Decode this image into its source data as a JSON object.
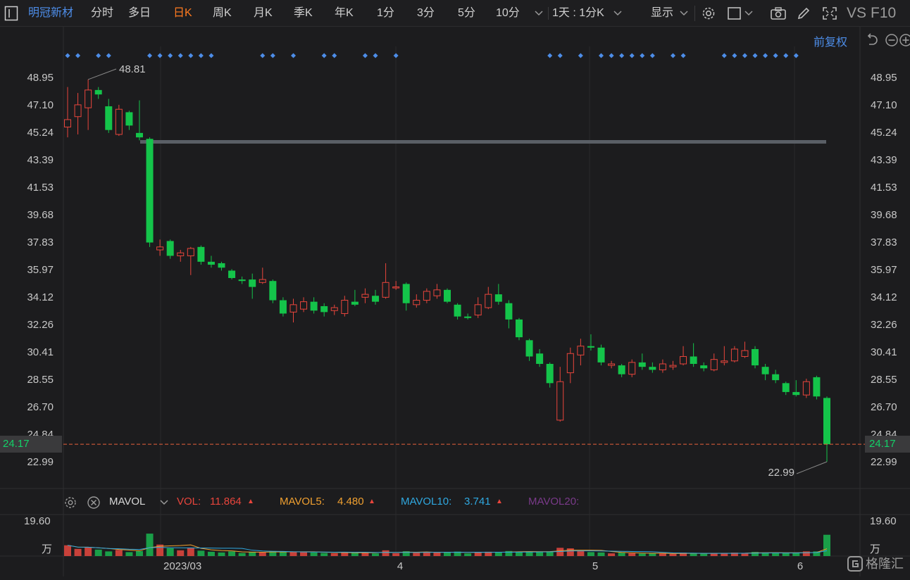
{
  "toolbar": {
    "stock_name": "明冠新材",
    "periods": [
      "分时",
      "多日",
      "日K",
      "周K",
      "月K",
      "季K",
      "年K",
      "1分",
      "3分",
      "5分",
      "10分"
    ],
    "active_period": "日K",
    "range_select": "1天 : 1分K",
    "display_label": "显示",
    "vs_label": "VS",
    "f10_label": "F10"
  },
  "chart_header": {
    "adjust_label": "前复权"
  },
  "price_axis": {
    "ticks": [
      "48.95",
      "47.10",
      "45.24",
      "43.39",
      "41.53",
      "39.68",
      "37.83",
      "35.97",
      "34.12",
      "32.26",
      "30.41",
      "28.55",
      "26.70",
      "24.84",
      "22.99"
    ],
    "current_price": "24.17",
    "high_label": "48.81",
    "low_label": "22.99"
  },
  "volume_panel": {
    "indicator": "MAVOL",
    "vol_label": "VOL:",
    "vol_value": "11.864",
    "mavol5_label": "MAVOL5:",
    "mavol5_value": "4.480",
    "mavol10_label": "MAVOL10:",
    "mavol10_value": "3.741",
    "mavol20_label": "MAVOL20:",
    "axis_max": "19.60",
    "axis_unit": "万"
  },
  "x_axis": {
    "labels": [
      "2023/03",
      "4",
      "5",
      "6"
    ]
  },
  "watermark": "格隆汇",
  "colors": {
    "up": "#e8453c",
    "down": "#14c44a",
    "accent": "#ff7a1f",
    "mavol5": "#f0a030",
    "mavol10": "#2fa8e0",
    "mavol20": "#8a3a9a",
    "stock": "#4d8de8"
  },
  "chart_data": {
    "type": "candlestick",
    "x_labels": [
      "2023/03",
      "4",
      "5",
      "6"
    ],
    "candles": [
      {
        "o": 45.6,
        "c": 46.1,
        "h": 48.3,
        "l": 44.9,
        "v": 6.0
      },
      {
        "o": 46.3,
        "c": 47.1,
        "h": 47.9,
        "l": 45.1,
        "v": 4.0
      },
      {
        "o": 46.9,
        "c": 48.1,
        "h": 48.81,
        "l": 45.4,
        "v": 4.8
      },
      {
        "o": 48.1,
        "c": 47.8,
        "h": 48.3,
        "l": 47.5,
        "v": 3.6
      },
      {
        "o": 47.0,
        "c": 45.4,
        "h": 47.5,
        "l": 45.2,
        "v": 2.6
      },
      {
        "o": 45.1,
        "c": 46.8,
        "h": 47.1,
        "l": 45.0,
        "v": 3.4
      },
      {
        "o": 46.6,
        "c": 45.7,
        "h": 46.7,
        "l": 45.4,
        "v": 2.2
      },
      {
        "o": 45.2,
        "c": 44.9,
        "h": 47.4,
        "l": 44.7,
        "v": 2.8
      },
      {
        "o": 44.8,
        "c": 37.8,
        "h": 44.9,
        "l": 37.5,
        "v": 12.5
      },
      {
        "o": 37.3,
        "c": 37.5,
        "h": 38.0,
        "l": 36.9,
        "v": 6.4
      },
      {
        "o": 37.9,
        "c": 36.9,
        "h": 38.0,
        "l": 36.7,
        "v": 4.4
      },
      {
        "o": 36.9,
        "c": 37.1,
        "h": 37.3,
        "l": 36.5,
        "v": 3.2
      },
      {
        "o": 36.9,
        "c": 37.4,
        "h": 37.5,
        "l": 35.6,
        "v": 4.5
      },
      {
        "o": 37.5,
        "c": 36.5,
        "h": 37.6,
        "l": 36.3,
        "v": 3.0
      },
      {
        "o": 36.5,
        "c": 36.3,
        "h": 36.9,
        "l": 36.1,
        "v": 2.4
      },
      {
        "o": 36.4,
        "c": 36.1,
        "h": 36.5,
        "l": 35.9,
        "v": 2.0
      },
      {
        "o": 35.9,
        "c": 35.4,
        "h": 36.0,
        "l": 35.3,
        "v": 2.6
      },
      {
        "o": 35.3,
        "c": 35.2,
        "h": 35.5,
        "l": 35.0,
        "v": 1.7
      },
      {
        "o": 35.3,
        "c": 34.8,
        "h": 35.7,
        "l": 34.0,
        "v": 2.4
      },
      {
        "o": 35.1,
        "c": 35.3,
        "h": 36.1,
        "l": 35.0,
        "v": 2.0
      },
      {
        "o": 35.2,
        "c": 33.9,
        "h": 35.3,
        "l": 33.7,
        "v": 2.8
      },
      {
        "o": 33.9,
        "c": 33.0,
        "h": 34.1,
        "l": 32.8,
        "v": 2.5
      },
      {
        "o": 33.1,
        "c": 33.6,
        "h": 34.0,
        "l": 32.4,
        "v": 2.4
      },
      {
        "o": 33.3,
        "c": 33.8,
        "h": 34.1,
        "l": 33.1,
        "v": 2.3
      },
      {
        "o": 33.8,
        "c": 33.2,
        "h": 34.1,
        "l": 33.0,
        "v": 2.0
      },
      {
        "o": 33.5,
        "c": 33.1,
        "h": 33.7,
        "l": 32.8,
        "v": 1.7
      },
      {
        "o": 33.2,
        "c": 33.4,
        "h": 33.6,
        "l": 32.9,
        "v": 1.6
      },
      {
        "o": 33.0,
        "c": 33.9,
        "h": 34.2,
        "l": 32.8,
        "v": 2.2
      },
      {
        "o": 33.8,
        "c": 33.6,
        "h": 34.6,
        "l": 33.5,
        "v": 1.8
      },
      {
        "o": 34.1,
        "c": 34.3,
        "h": 34.7,
        "l": 33.7,
        "v": 2.1
      },
      {
        "o": 34.2,
        "c": 33.8,
        "h": 34.6,
        "l": 33.6,
        "v": 1.5
      },
      {
        "o": 34.1,
        "c": 35.1,
        "h": 36.4,
        "l": 34.0,
        "v": 3.2
      },
      {
        "o": 34.8,
        "c": 34.8,
        "h": 35.2,
        "l": 34.6,
        "v": 1.6
      },
      {
        "o": 35.0,
        "c": 33.7,
        "h": 35.1,
        "l": 33.2,
        "v": 2.7
      },
      {
        "o": 33.6,
        "c": 33.9,
        "h": 34.3,
        "l": 33.4,
        "v": 1.9
      },
      {
        "o": 33.9,
        "c": 34.5,
        "h": 34.7,
        "l": 33.7,
        "v": 2.2
      },
      {
        "o": 34.2,
        "c": 34.6,
        "h": 35.0,
        "l": 34.0,
        "v": 2.0
      },
      {
        "o": 34.6,
        "c": 33.8,
        "h": 34.7,
        "l": 33.7,
        "v": 2.0
      },
      {
        "o": 33.6,
        "c": 32.8,
        "h": 33.7,
        "l": 32.6,
        "v": 2.5
      },
      {
        "o": 32.8,
        "c": 32.7,
        "h": 33.0,
        "l": 32.6,
        "v": 1.5
      },
      {
        "o": 32.9,
        "c": 33.6,
        "h": 34.1,
        "l": 32.7,
        "v": 2.2
      },
      {
        "o": 33.4,
        "c": 34.3,
        "h": 34.8,
        "l": 33.3,
        "v": 2.4
      },
      {
        "o": 34.3,
        "c": 33.8,
        "h": 35.0,
        "l": 33.6,
        "v": 2.2
      },
      {
        "o": 33.7,
        "c": 32.6,
        "h": 33.9,
        "l": 32.0,
        "v": 2.8
      },
      {
        "o": 32.6,
        "c": 31.4,
        "h": 32.7,
        "l": 31.2,
        "v": 2.4
      },
      {
        "o": 31.2,
        "c": 30.1,
        "h": 31.3,
        "l": 29.8,
        "v": 2.6
      },
      {
        "o": 30.3,
        "c": 29.6,
        "h": 30.6,
        "l": 29.4,
        "v": 2.2
      },
      {
        "o": 29.6,
        "c": 28.3,
        "h": 29.7,
        "l": 28.0,
        "v": 2.6
      },
      {
        "o": 25.8,
        "c": 28.4,
        "h": 29.4,
        "l": 25.7,
        "v": 4.6
      },
      {
        "o": 29.0,
        "c": 30.3,
        "h": 30.7,
        "l": 28.3,
        "v": 4.3
      },
      {
        "o": 30.2,
        "c": 30.8,
        "h": 31.3,
        "l": 29.5,
        "v": 2.8
      },
      {
        "o": 30.8,
        "c": 30.7,
        "h": 31.6,
        "l": 30.5,
        "v": 2.2
      },
      {
        "o": 30.7,
        "c": 29.7,
        "h": 30.9,
        "l": 29.5,
        "v": 2.0
      },
      {
        "o": 29.5,
        "c": 29.6,
        "h": 29.8,
        "l": 29.3,
        "v": 1.5
      },
      {
        "o": 29.5,
        "c": 28.9,
        "h": 29.6,
        "l": 28.7,
        "v": 1.9
      },
      {
        "o": 28.9,
        "c": 29.7,
        "h": 29.9,
        "l": 28.7,
        "v": 1.6
      },
      {
        "o": 29.7,
        "c": 29.4,
        "h": 30.3,
        "l": 29.2,
        "v": 1.4
      },
      {
        "o": 29.4,
        "c": 29.2,
        "h": 29.7,
        "l": 29.0,
        "v": 1.5
      },
      {
        "o": 29.2,
        "c": 29.6,
        "h": 29.9,
        "l": 29.0,
        "v": 1.4
      },
      {
        "o": 29.4,
        "c": 29.5,
        "h": 29.8,
        "l": 29.2,
        "v": 1.2
      },
      {
        "o": 29.6,
        "c": 30.1,
        "h": 30.8,
        "l": 29.5,
        "v": 1.9
      },
      {
        "o": 30.1,
        "c": 29.6,
        "h": 31.0,
        "l": 29.4,
        "v": 1.6
      },
      {
        "o": 29.5,
        "c": 29.3,
        "h": 29.7,
        "l": 29.1,
        "v": 1.3
      },
      {
        "o": 29.2,
        "c": 29.9,
        "h": 30.3,
        "l": 29.1,
        "v": 1.6
      },
      {
        "o": 29.7,
        "c": 29.8,
        "h": 30.8,
        "l": 29.5,
        "v": 1.5
      },
      {
        "o": 29.8,
        "c": 30.6,
        "h": 30.8,
        "l": 29.7,
        "v": 1.9
      },
      {
        "o": 30.1,
        "c": 30.5,
        "h": 31.1,
        "l": 30.0,
        "v": 1.7
      },
      {
        "o": 30.6,
        "c": 29.5,
        "h": 30.8,
        "l": 29.3,
        "v": 2.3
      },
      {
        "o": 29.4,
        "c": 28.9,
        "h": 29.6,
        "l": 28.5,
        "v": 2.0
      },
      {
        "o": 28.9,
        "c": 28.5,
        "h": 29.2,
        "l": 28.3,
        "v": 1.6
      },
      {
        "o": 28.3,
        "c": 27.7,
        "h": 28.4,
        "l": 27.5,
        "v": 1.7
      },
      {
        "o": 27.7,
        "c": 27.5,
        "h": 28.5,
        "l": 27.4,
        "v": 1.6
      },
      {
        "o": 27.5,
        "c": 28.4,
        "h": 28.6,
        "l": 27.3,
        "v": 2.6
      },
      {
        "o": 28.7,
        "c": 27.4,
        "h": 28.8,
        "l": 27.2,
        "v": 2.6
      },
      {
        "o": 27.3,
        "c": 24.17,
        "h": 27.4,
        "l": 22.99,
        "v": 11.864
      }
    ],
    "volume_ylim": [
      0,
      19.6
    ],
    "price_ylim": [
      22.99,
      48.95
    ]
  }
}
